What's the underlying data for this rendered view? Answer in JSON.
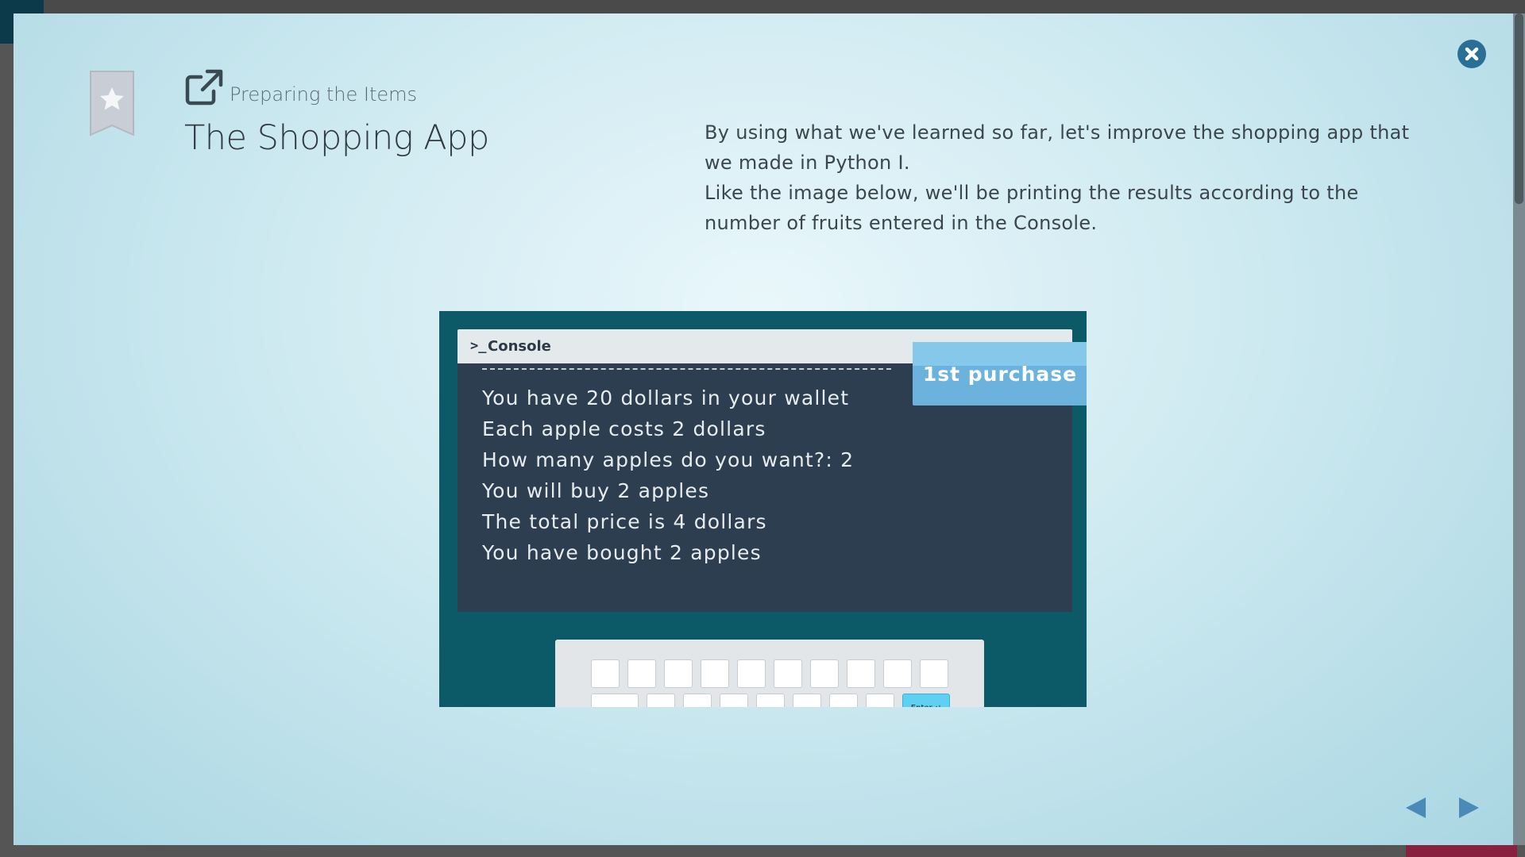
{
  "header": {
    "eyebrow": "Preparing the Items",
    "title": "The Shopping App",
    "bookmark_icon": "star-bookmark-icon",
    "open_icon": "external-link-icon"
  },
  "description": {
    "paragraph_1": "By using what we've learned so far, let's improve the shopping app that we made in Python I.",
    "paragraph_2": "Like the image below, we'll be printing the results according to the number of fruits entered in the Console."
  },
  "figure": {
    "console_label": "Console",
    "console_prompt": ">_",
    "tag": "1st purchase",
    "lines": [
      "You have 20 dollars in your wallet",
      "Each apple costs 2 dollars",
      "How many apples do you want?: 2",
      "You will buy 2 apples",
      "The total price is 4 dollars",
      "You have bought 2 apples"
    ],
    "enter_key": "Enter ↵"
  },
  "controls": {
    "close_icon": "close-icon",
    "prev_icon": "triangle-left-icon",
    "next_icon": "triangle-right-icon"
  },
  "colors": {
    "accent": "#2a6f96",
    "figure_bg": "#0c5a67",
    "console_bg": "#2c3e50",
    "tag_bg": "#6bb3dd"
  }
}
